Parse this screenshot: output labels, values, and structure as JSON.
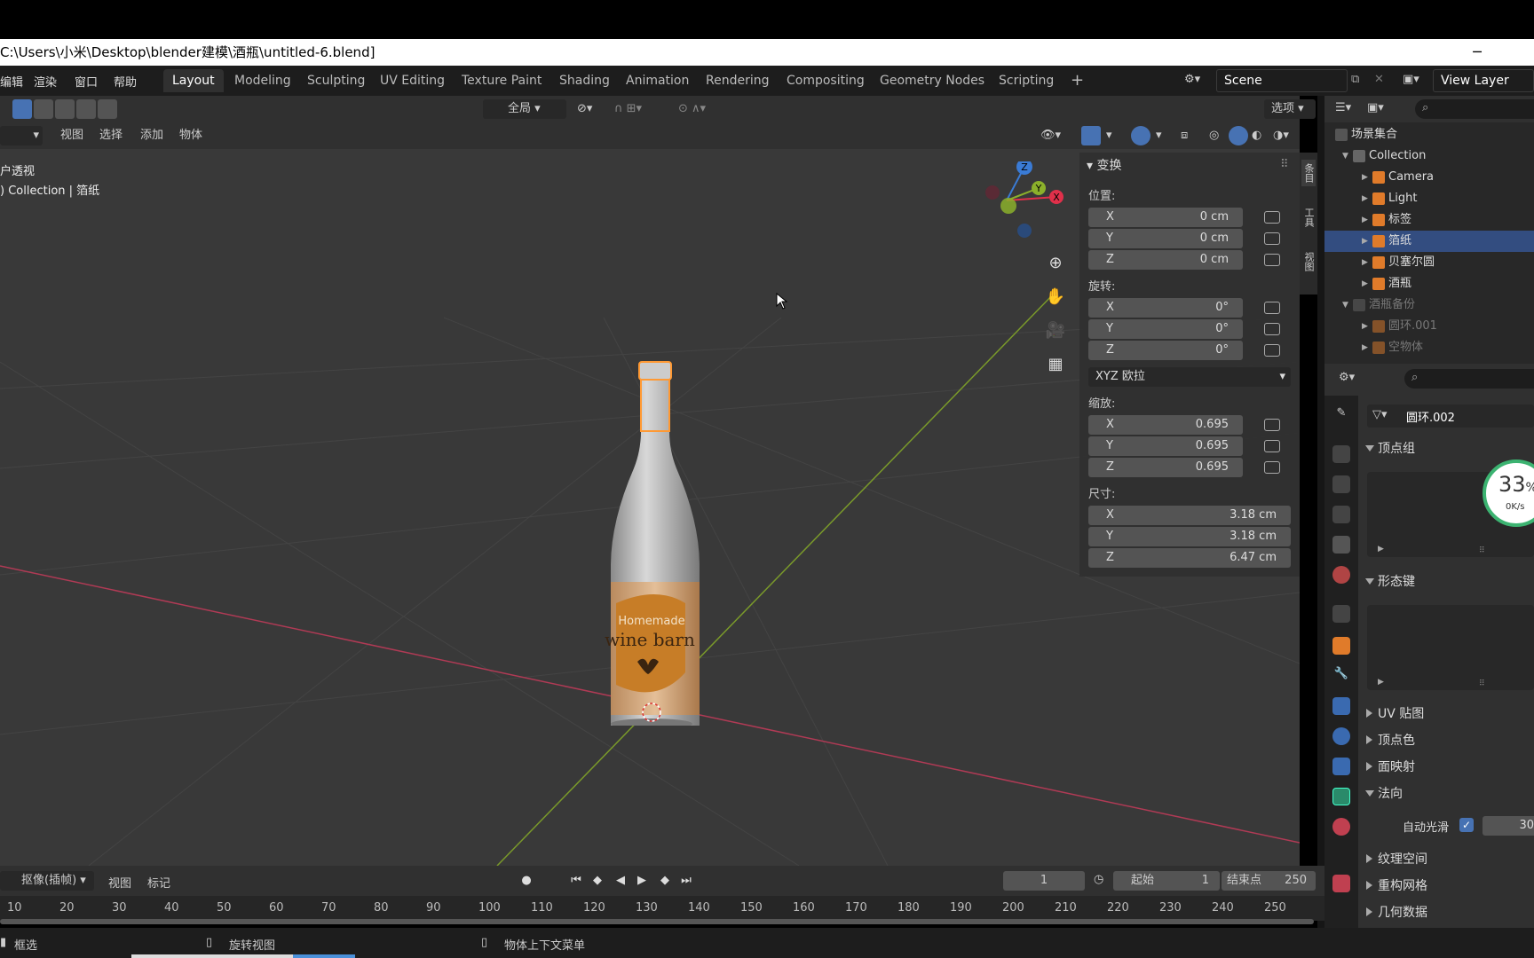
{
  "title_bar": {
    "path": "C:\\Users\\小米\\Desktop\\blender建模\\酒瓶\\untitled-6.blend]",
    "minimize": "─"
  },
  "menu": [
    "编辑",
    "渲染",
    "窗口",
    "帮助"
  ],
  "workspaces": [
    "Layout",
    "Modeling",
    "Sculpting",
    "UV Editing",
    "Texture Paint",
    "Shading",
    "Animation",
    "Rendering",
    "Compositing",
    "Geometry Nodes",
    "Scripting",
    "+"
  ],
  "active_workspace": "Layout",
  "scene": {
    "name": "Scene",
    "view_layer": "View Layer"
  },
  "viewport_header": {
    "transform_orientation": "全局",
    "options": "选项",
    "menus": [
      "视图",
      "选择",
      "添加",
      "物体"
    ]
  },
  "viewport": {
    "view_name": "户透视",
    "collection_info": ") Collection | 箔纸",
    "bottle_label_line1": "Homemade",
    "bottle_label_line2": "wine barn",
    "gizmo": {
      "z": "Z",
      "y": "Y",
      "x": "X"
    }
  },
  "npanel": {
    "header": "变换",
    "location_label": "位置:",
    "location": [
      {
        "axis": "X",
        "value": "0 cm"
      },
      {
        "axis": "Y",
        "value": "0 cm"
      },
      {
        "axis": "Z",
        "value": "0 cm"
      }
    ],
    "rotation_label": "旋转:",
    "rotation": [
      {
        "axis": "X",
        "value": "0°"
      },
      {
        "axis": "Y",
        "value": "0°"
      },
      {
        "axis": "Z",
        "value": "0°"
      }
    ],
    "rotation_mode": "XYZ 欧拉",
    "scale_label": "缩放:",
    "scale": [
      {
        "axis": "X",
        "value": "0.695"
      },
      {
        "axis": "Y",
        "value": "0.695"
      },
      {
        "axis": "Z",
        "value": "0.695"
      }
    ],
    "dimensions_label": "尺寸:",
    "dimensions": [
      {
        "axis": "X",
        "value": "3.18 cm"
      },
      {
        "axis": "Y",
        "value": "3.18 cm"
      },
      {
        "axis": "Z",
        "value": "6.47 cm"
      }
    ],
    "side_tabs": [
      "条目",
      "工具",
      "视图"
    ]
  },
  "outliner": {
    "root": "场景集合",
    "rows": [
      {
        "label": "Collection",
        "indent": 1,
        "icon": "collection-icon",
        "state": "normal"
      },
      {
        "label": "Camera",
        "indent": 2,
        "icon": "camera-icon",
        "state": "normal"
      },
      {
        "label": "Light",
        "indent": 2,
        "icon": "light-icon",
        "state": "normal"
      },
      {
        "label": "标签",
        "indent": 2,
        "icon": "mesh-icon",
        "state": "normal"
      },
      {
        "label": "箔纸",
        "indent": 2,
        "icon": "mesh-icon",
        "state": "selected"
      },
      {
        "label": "贝塞尔圆",
        "indent": 2,
        "icon": "curve-icon",
        "state": "normal"
      },
      {
        "label": "酒瓶",
        "indent": 2,
        "icon": "mesh-icon",
        "state": "normal"
      },
      {
        "label": "酒瓶备份",
        "indent": 1,
        "icon": "collection-icon",
        "state": "dim"
      },
      {
        "label": "圆环.001",
        "indent": 2,
        "icon": "mesh-icon",
        "state": "dim"
      },
      {
        "label": "空物体",
        "indent": 2,
        "icon": "empty-icon",
        "state": "dim"
      }
    ]
  },
  "properties": {
    "mesh_name": "圆环.002",
    "sections": [
      {
        "label": "顶点组",
        "open": true
      },
      {
        "label": "形态键",
        "open": true
      },
      {
        "label": "UV 贴图",
        "open": false
      },
      {
        "label": "顶点色",
        "open": false
      },
      {
        "label": "面映射",
        "open": false
      },
      {
        "label": "法向",
        "open": true
      },
      {
        "label": "纹理空间",
        "open": false
      },
      {
        "label": "重构网格",
        "open": false
      },
      {
        "label": "几何数据",
        "open": false
      }
    ],
    "autosmooth_label": "自动光滑",
    "autosmooth_value": "30",
    "overlay_percent": "33",
    "overlay_unit": "%",
    "overlay_speed": "0K/s"
  },
  "timeline": {
    "mode": "抠像(插帧)",
    "menus": [
      "视图",
      "标记"
    ],
    "current_frame": "1",
    "start_label": "起始",
    "start": "1",
    "end_label": "结束点",
    "end": "250",
    "ticks": [
      "10",
      "20",
      "30",
      "40",
      "50",
      "60",
      "70",
      "80",
      "90",
      "100",
      "110",
      "120",
      "130",
      "140",
      "150",
      "160",
      "170",
      "180",
      "190",
      "200",
      "210",
      "220",
      "230",
      "240",
      "250"
    ]
  },
  "status_bar": {
    "left": "框选",
    "middle": "旋转视图",
    "right": "物体上下文菜单"
  },
  "colors": {
    "accent_blue": "#4772b3",
    "selected_row": "#334d80",
    "x_axis": "#c8304a",
    "y_axis": "#7a9a2a"
  }
}
